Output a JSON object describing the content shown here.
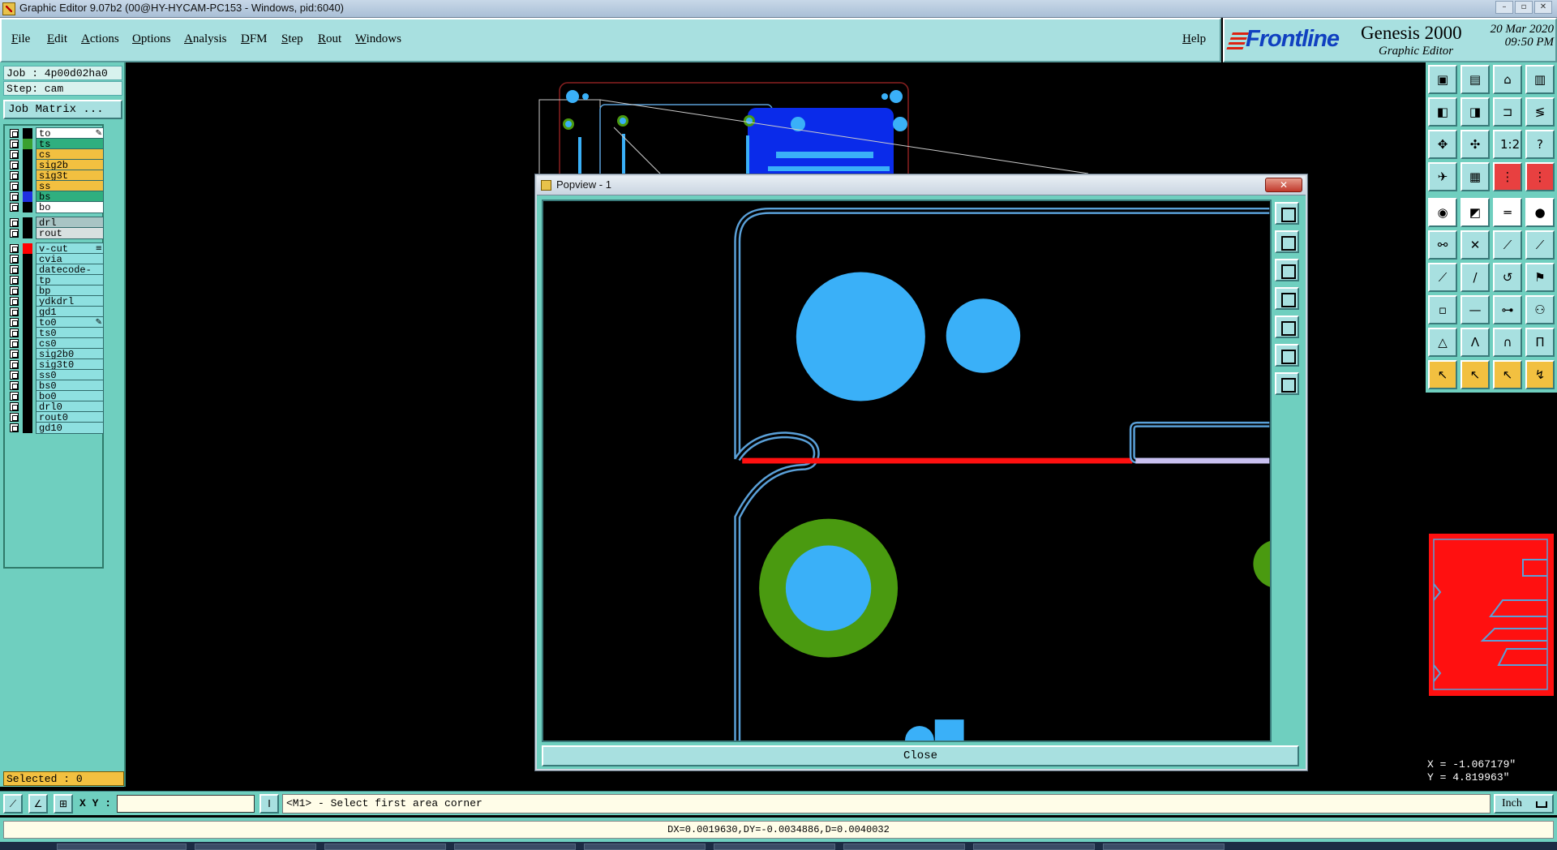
{
  "window": {
    "title": "Graphic Editor 9.07b2 (00@HY-HYCAM-PC153 - Windows, pid:6040)",
    "controls": [
      "–",
      "▫",
      "✕"
    ]
  },
  "menu": {
    "items": [
      "File",
      "Edit",
      "Actions",
      "Options",
      "Analysis",
      "DFM",
      "Step",
      "Rout",
      "Windows"
    ],
    "help": "Help"
  },
  "brand": {
    "logo": "Frontline",
    "product": "Genesis 2000",
    "subtitle": "Graphic Editor",
    "date": "20 Mar 2020",
    "time": "09:50 PM"
  },
  "left_panel": {
    "job": "Job : 4p00d02ha0",
    "step": "Step: cam",
    "job_matrix_label": "Job Matrix ...",
    "selected": "Selected : 0",
    "layers": [
      {
        "name": "to",
        "bg": "#ffffff",
        "swatch": "#000000",
        "mark": "✎"
      },
      {
        "name": "ts",
        "bg": "#2faf7f",
        "swatch": "#3aa030",
        "mark": ""
      },
      {
        "name": "cs",
        "bg": "#f2c040",
        "swatch": "#000000",
        "mark": ""
      },
      {
        "name": "sig2b",
        "bg": "#f2c040",
        "swatch": "#000000",
        "mark": ""
      },
      {
        "name": "sig3t",
        "bg": "#f2c040",
        "swatch": "#000000",
        "mark": ""
      },
      {
        "name": "ss",
        "bg": "#f2c040",
        "swatch": "#000000",
        "mark": ""
      },
      {
        "name": "bs",
        "bg": "#2faf7f",
        "swatch": "#2030e0",
        "mark": ""
      },
      {
        "name": "bo",
        "bg": "#ffffff",
        "swatch": "#000000",
        "mark": ""
      },
      {
        "name": "drl",
        "bg": "#a8c4c4",
        "swatch": "#000000",
        "mark": ""
      },
      {
        "name": "rout",
        "bg": "#d8e0e0",
        "swatch": "#000000",
        "mark": ""
      },
      {
        "name": "v-cut",
        "bg": "#8ee0e0",
        "swatch": "#ff0000",
        "mark": "≡"
      },
      {
        "name": "cvia",
        "bg": "#8ee0e0",
        "swatch": "#000000",
        "mark": ""
      },
      {
        "name": "datecode-to",
        "bg": "#8ee0e0",
        "swatch": "#000000",
        "mark": ""
      },
      {
        "name": "tp",
        "bg": "#8ee0e0",
        "swatch": "#000000",
        "mark": ""
      },
      {
        "name": "bp",
        "bg": "#8ee0e0",
        "swatch": "#000000",
        "mark": ""
      },
      {
        "name": "ydkdrl",
        "bg": "#8ee0e0",
        "swatch": "#000000",
        "mark": ""
      },
      {
        "name": "gd1",
        "bg": "#8ee0e0",
        "swatch": "#000000",
        "mark": ""
      },
      {
        "name": "to0",
        "bg": "#8ee0e0",
        "swatch": "#000000",
        "mark": "✎"
      },
      {
        "name": "ts0",
        "bg": "#8ee0e0",
        "swatch": "#000000",
        "mark": ""
      },
      {
        "name": "cs0",
        "bg": "#8ee0e0",
        "swatch": "#000000",
        "mark": ""
      },
      {
        "name": "sig2b0",
        "bg": "#8ee0e0",
        "swatch": "#000000",
        "mark": ""
      },
      {
        "name": "sig3t0",
        "bg": "#8ee0e0",
        "swatch": "#000000",
        "mark": ""
      },
      {
        "name": "ss0",
        "bg": "#8ee0e0",
        "swatch": "#000000",
        "mark": ""
      },
      {
        "name": "bs0",
        "bg": "#8ee0e0",
        "swatch": "#000000",
        "mark": ""
      },
      {
        "name": "bo0",
        "bg": "#8ee0e0",
        "swatch": "#000000",
        "mark": ""
      },
      {
        "name": "drl0",
        "bg": "#8ee0e0",
        "swatch": "#000000",
        "mark": ""
      },
      {
        "name": "rout0",
        "bg": "#8ee0e0",
        "swatch": "#000000",
        "mark": ""
      },
      {
        "name": "gd10",
        "bg": "#8ee0e0",
        "swatch": "#000000",
        "mark": ""
      }
    ]
  },
  "popview": {
    "title": "Popview - 1",
    "close_label": "Close",
    "close_x": "✕",
    "tools": [
      "zoom-window-icon",
      "zoom-in-icon",
      "zoom-out-icon",
      "pan-left-icon",
      "pan-right-icon",
      "fit-all-icon",
      "center-icon"
    ]
  },
  "right_tools": [
    {
      "icon": "open-step-icon",
      "glyph": "▣",
      "style": ""
    },
    {
      "icon": "save-icon",
      "glyph": "▤",
      "style": ""
    },
    {
      "icon": "home-icon",
      "glyph": "⌂",
      "style": ""
    },
    {
      "icon": "panel-icon",
      "glyph": "▥",
      "style": ""
    },
    {
      "icon": "move-left-icon",
      "glyph": "◧",
      "style": ""
    },
    {
      "icon": "move-right-icon",
      "glyph": "◨",
      "style": ""
    },
    {
      "icon": "snap-icon",
      "glyph": "⊐",
      "style": ""
    },
    {
      "icon": "route-icon",
      "glyph": "≶",
      "style": ""
    },
    {
      "icon": "zoom-fit-icon",
      "glyph": "✥",
      "style": ""
    },
    {
      "icon": "zoom-center-icon",
      "glyph": "✣",
      "style": ""
    },
    {
      "icon": "scale-icon",
      "glyph": "1:2",
      "style": ""
    },
    {
      "icon": "query-icon",
      "glyph": "?",
      "style": ""
    },
    {
      "icon": "helicopter-icon",
      "glyph": "✈",
      "style": ""
    },
    {
      "icon": "grid-icon",
      "glyph": "▦",
      "style": ""
    },
    {
      "icon": "layer-stack-icon",
      "glyph": "⋮",
      "style": "red"
    },
    {
      "icon": "layer-swap-icon",
      "glyph": "⋮",
      "style": "red"
    },
    {
      "icon": "pad-icon",
      "glyph": "◉",
      "style": "white"
    },
    {
      "icon": "line-icon",
      "glyph": "◩",
      "style": "white"
    },
    {
      "icon": "measure-icon",
      "glyph": "═",
      "style": "white"
    },
    {
      "icon": "circle-icon",
      "glyph": "●",
      "style": "white"
    },
    {
      "icon": "connect-icon",
      "glyph": "⚯",
      "style": ""
    },
    {
      "icon": "cross-icon",
      "glyph": "✕",
      "style": ""
    },
    {
      "icon": "node-icon",
      "glyph": "⟋",
      "style": ""
    },
    {
      "icon": "node-red-icon",
      "glyph": "⟋",
      "style": ""
    },
    {
      "icon": "slope-icon",
      "glyph": "⟋",
      "style": ""
    },
    {
      "icon": "slash-icon",
      "glyph": "/",
      "style": ""
    },
    {
      "icon": "arc-icon",
      "glyph": "↺",
      "style": ""
    },
    {
      "icon": "flag-icon",
      "glyph": "⚑",
      "style": ""
    },
    {
      "icon": "snap-pad-icon",
      "glyph": "▫",
      "style": ""
    },
    {
      "icon": "dash-icon",
      "glyph": "—",
      "style": ""
    },
    {
      "icon": "align-icon",
      "glyph": "⊶",
      "style": ""
    },
    {
      "icon": "pads-icon",
      "glyph": "⚇",
      "style": ""
    },
    {
      "icon": "triangle-icon",
      "glyph": "△",
      "style": ""
    },
    {
      "icon": "angle-icon",
      "glyph": "Λ",
      "style": ""
    },
    {
      "icon": "arch-icon",
      "glyph": "∩",
      "style": ""
    },
    {
      "icon": "bridge-icon",
      "glyph": "Π",
      "style": ""
    },
    {
      "icon": "pointer-icon",
      "glyph": "↖",
      "style": "yellow"
    },
    {
      "icon": "pointer-select-icon",
      "glyph": "↖",
      "style": "yellow"
    },
    {
      "icon": "pointer-edit-icon",
      "glyph": "↖",
      "style": "yellow"
    },
    {
      "icon": "pointer-route-icon",
      "glyph": "↯",
      "style": "yellow"
    }
  ],
  "coords": {
    "x": "X = -1.067179\"",
    "y": "Y = 4.819963\""
  },
  "cmdbar": {
    "xy_label": "X Y :",
    "xy_value": "",
    "prompt": "<M1> - Select first area corner",
    "unit": "Inch",
    "tools": [
      "line-tool-icon",
      "arc-tool-icon",
      "grid-tool-icon"
    ]
  },
  "status": {
    "text": "DX=0.0019630,DY=-0.0034886,D=0.0040032"
  },
  "colors": {
    "panel": "#6fcfbf",
    "menu": "#a8e0e0",
    "copper_blue": "#3ab0f8",
    "mask_green": "#4a9a10",
    "vcut_red": "#ff1010",
    "outline_blue": "#5aa0d8"
  }
}
